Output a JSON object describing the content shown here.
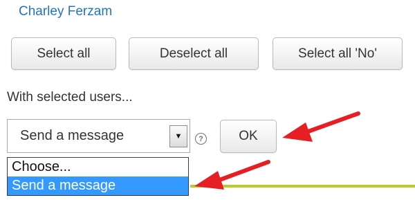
{
  "user": {
    "name": "Charley Ferzam"
  },
  "buttons": {
    "select_all": "Select all",
    "deselect_all": "Deselect all",
    "select_all_no": "Select all 'No'",
    "ok": "OK"
  },
  "bulk_actions": {
    "label": "With selected users...",
    "selected_value": "Send a message",
    "help_glyph": "?",
    "arrow_glyph": "▼",
    "options": [
      "Choose...",
      "Send a message"
    ],
    "highlighted_option_index": 1
  },
  "colors": {
    "link": "#1f74c4",
    "highlight": "#3399ff",
    "annotation_arrow": "#e51f24",
    "accent_line": "#b6cc2a"
  },
  "icons": {
    "help": "help-icon",
    "dropdown": "chevron-down-icon",
    "annotations": "arrow-annotation-icon"
  }
}
